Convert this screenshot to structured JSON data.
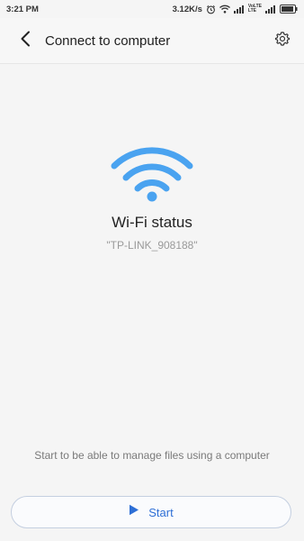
{
  "status_bar": {
    "time": "3:21 PM",
    "speed": "3.12K/s",
    "volte_top": "VoLTE",
    "volte_bottom": "LTE",
    "battery_icon": "battery-icon"
  },
  "header": {
    "title": "Connect to computer",
    "back_icon": "chevron-left-icon",
    "settings_icon": "gear-icon"
  },
  "main": {
    "wifi_icon": "wifi-icon",
    "status_title": "Wi-Fi status",
    "ssid": "\"TP-LINK_908188\"",
    "hint": "Start to be able to manage files using a computer"
  },
  "start_button": {
    "label": "Start",
    "icon": "play-icon"
  },
  "colors": {
    "wifi": "#4aa3f0",
    "accent": "#2e6fd6"
  }
}
